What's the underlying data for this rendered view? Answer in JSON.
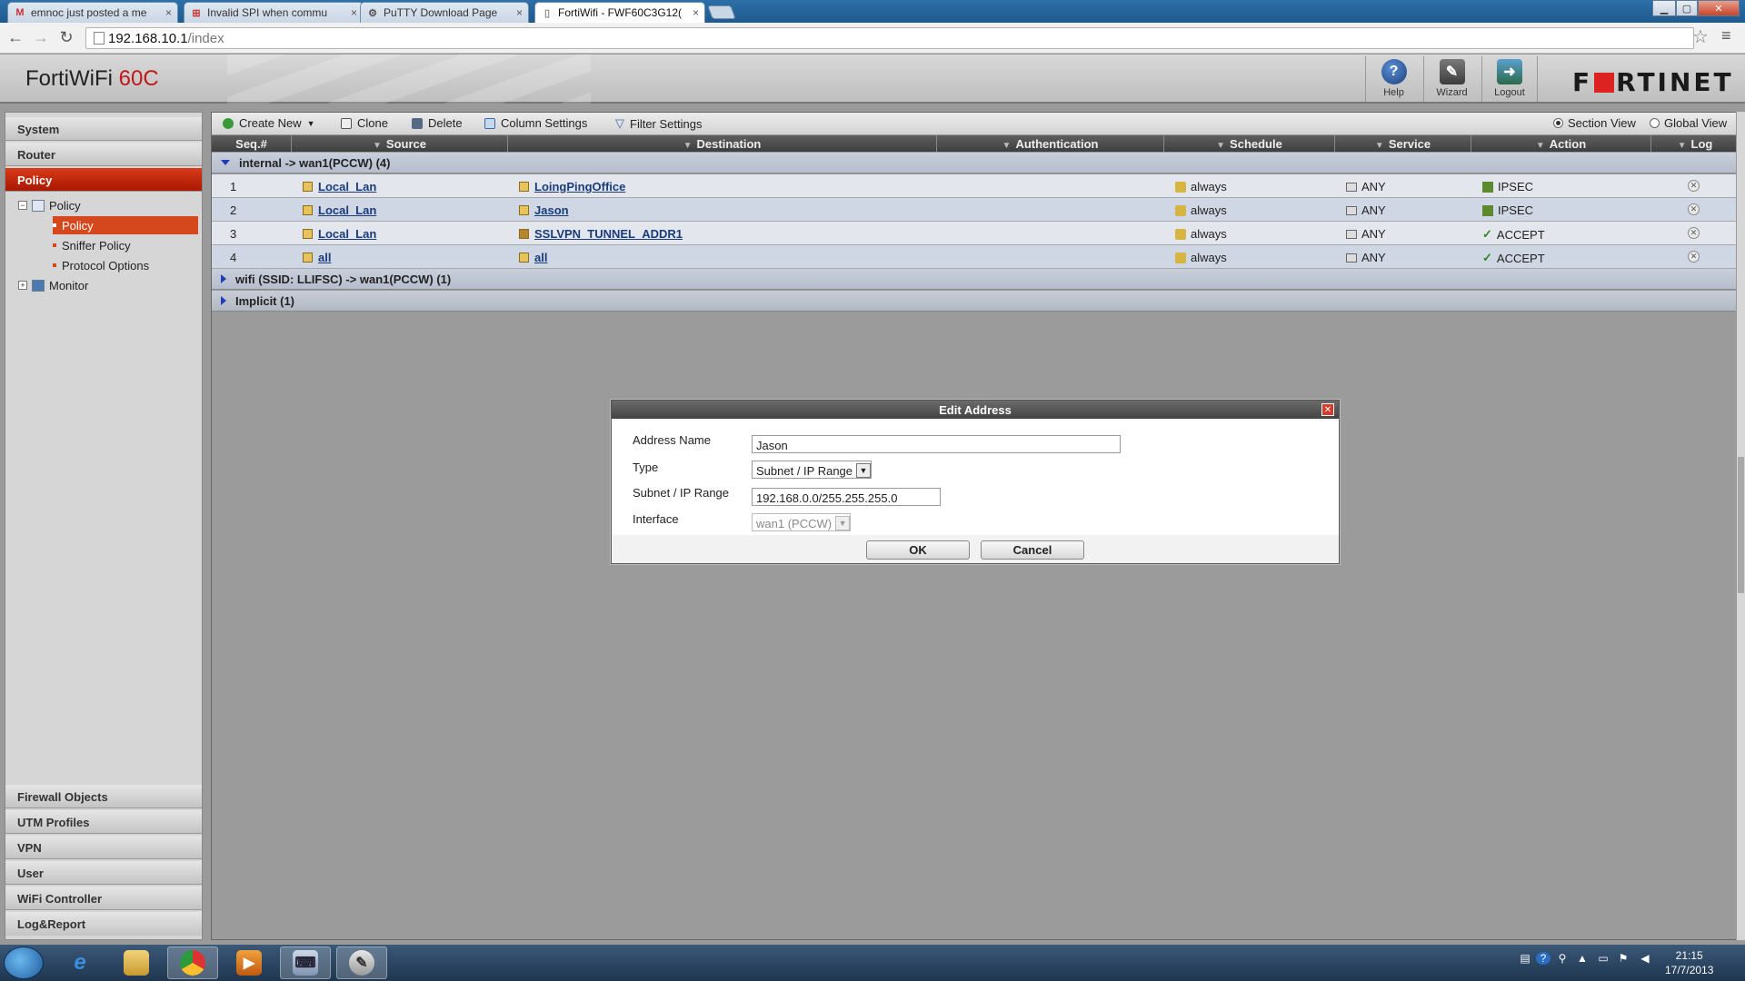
{
  "browser": {
    "tabs": [
      {
        "label": "emnoc just posted a me",
        "close": "×"
      },
      {
        "label": "Invalid SPI when commu",
        "close": "×"
      },
      {
        "label": "PuTTY Download Page",
        "close": "×"
      },
      {
        "label": "FortiWifi - FWF60C3G12(",
        "close": "×"
      }
    ],
    "url_host": "192.168.10.1",
    "url_path": "/index"
  },
  "header": {
    "brand": "FortiWiFi",
    "model": "60C",
    "buttons": [
      {
        "label": "Help",
        "icon": "help-icon"
      },
      {
        "label": "Wizard",
        "icon": "wizard-icon"
      },
      {
        "label": "Logout",
        "icon": "logout-icon"
      }
    ],
    "logo_left": "F",
    "logo_right": "RTINET"
  },
  "sidebar": {
    "top_sections": [
      "System",
      "Router",
      "Policy"
    ],
    "tree": {
      "policy_folder": "Policy",
      "policy_item": "Policy",
      "sniffer": "Sniffer Policy",
      "protocol": "Protocol Options",
      "monitor": "Monitor"
    },
    "bottom_sections": [
      "Firewall Objects",
      "UTM Profiles",
      "VPN",
      "User",
      "WiFi Controller",
      "Log&Report"
    ]
  },
  "toolbar": {
    "create_new": "Create New",
    "clone": "Clone",
    "delete": "Delete",
    "column_settings": "Column Settings",
    "filter_settings": "Filter Settings",
    "section_view": "Section View",
    "global_view": "Global View",
    "selected_view": "section"
  },
  "table": {
    "headers": {
      "seq": "Seq.#",
      "source": "Source",
      "destination": "Destination",
      "authentication": "Authentication",
      "schedule": "Schedule",
      "service": "Service",
      "action": "Action",
      "log": "Log"
    },
    "groups": [
      {
        "label": "internal -> wan1(PCCW) (4)",
        "expanded": true
      },
      {
        "label": "wifi (SSID: LLIFSC) -> wan1(PCCW) (1)",
        "expanded": false
      },
      {
        "label": "Implicit (1)",
        "expanded": false
      }
    ],
    "rows": [
      {
        "seq": "1",
        "source": "Local_Lan",
        "destination": "LoingPingOffice",
        "schedule": "always",
        "service": "ANY",
        "action": "IPSEC"
      },
      {
        "seq": "2",
        "source": "Local_Lan",
        "destination": "Jason",
        "schedule": "always",
        "service": "ANY",
        "action": "IPSEC"
      },
      {
        "seq": "3",
        "source": "Local_Lan",
        "destination": "SSLVPN_TUNNEL_ADDR1",
        "schedule": "always",
        "service": "ANY",
        "action": "ACCEPT"
      },
      {
        "seq": "4",
        "source": "all",
        "destination": "all",
        "schedule": "always",
        "service": "ANY",
        "action": "ACCEPT"
      }
    ]
  },
  "dialog": {
    "title": "Edit Address",
    "address_name_label": "Address Name",
    "address_name_value": "Jason",
    "type_label": "Type",
    "type_value": "Subnet / IP Range",
    "subnet_label": "Subnet / IP Range",
    "subnet_value": "192.168.0.0/255.255.255.0",
    "interface_label": "Interface",
    "interface_value": "wan1 (PCCW)",
    "ok": "OK",
    "cancel": "Cancel"
  },
  "taskbar": {
    "time": "21:15",
    "date": "17/7/2013"
  },
  "colors": {
    "accent": "#d5481e",
    "link": "#1a3c7a",
    "group_arrow": "#1c3fb5"
  }
}
